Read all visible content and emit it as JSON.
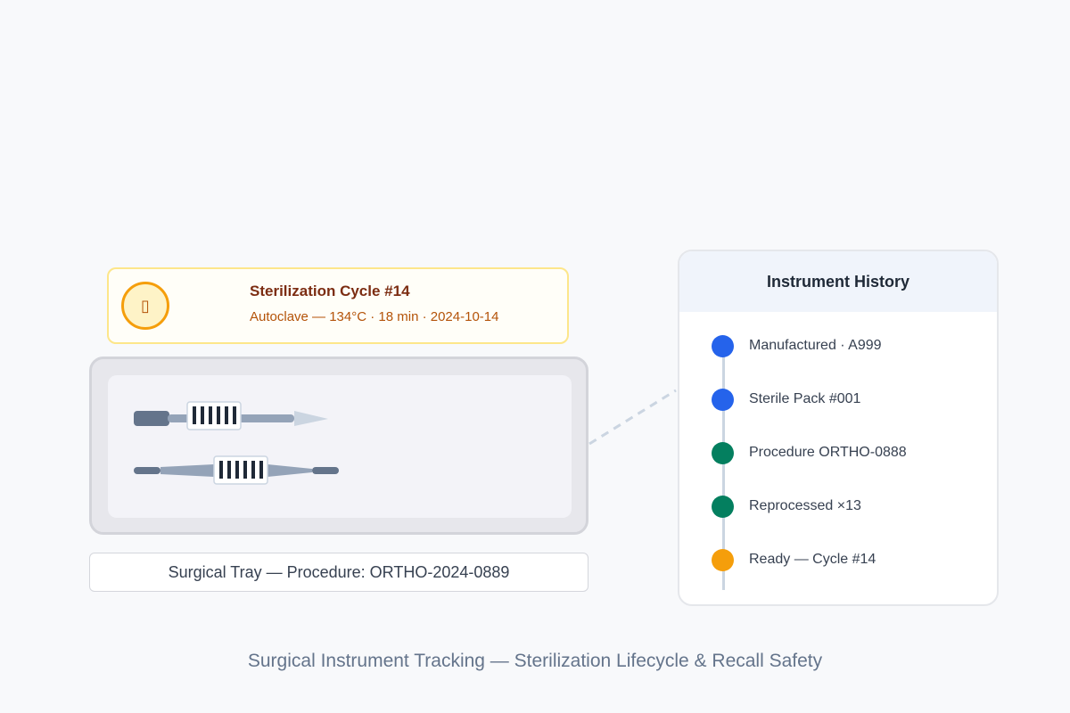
{
  "cycle": {
    "icon": "sterilization-icon",
    "icon_glyph": "▯",
    "title": "Sterilization Cycle #14",
    "detail": "Autoclave — 134°C · 18 min · 2024-10-14"
  },
  "tray": {
    "label": "Surgical Tray — Procedure: ORTHO-2024-0889"
  },
  "history": {
    "title": "Instrument History",
    "items": [
      {
        "label": "Manufactured · A999",
        "color": "#2563eb"
      },
      {
        "label": "Sterile Pack #001",
        "color": "#2563eb"
      },
      {
        "label": "Procedure ORTHO-0888",
        "color": "#047f5f"
      },
      {
        "label": "Reprocessed ×13",
        "color": "#047f5f"
      },
      {
        "label": "Ready — Cycle #14",
        "color": "#f59e0b"
      }
    ]
  },
  "caption": "Surgical Instrument Tracking — Sterilization Lifecycle & Recall Safety"
}
